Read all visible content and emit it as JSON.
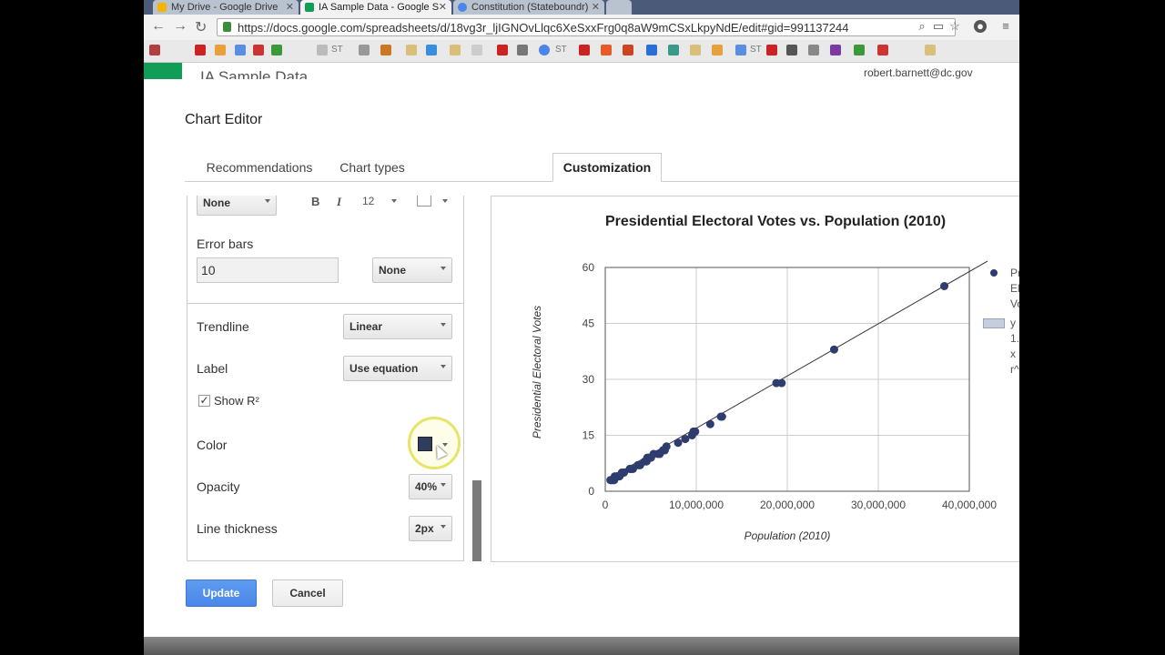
{
  "browser": {
    "tabs": [
      {
        "label": "My Drive - Google Drive"
      },
      {
        "label": "IA Sample Data - Google S"
      },
      {
        "label": "Constitution (Stateboundr)"
      }
    ],
    "url": "https://docs.google.com/spreadsheets/d/18vg3r_ljIGNOvLlqc6XeSxxFrg0q8aW9mCSxLkpyNdE/edit#gid=991137244",
    "bookmark_labels": [
      "ST",
      "ST",
      "ST"
    ]
  },
  "sheet": {
    "title": "IA Sample Data",
    "user_email": "robert.barnett@dc.gov"
  },
  "dialog": {
    "title": "Chart Editor",
    "tabs": [
      {
        "label": "Recommendations"
      },
      {
        "label": "Chart types"
      },
      {
        "label": "Customization"
      }
    ],
    "panel": {
      "point_shape_value": "None",
      "font_size": "12",
      "bold_label": "B",
      "italic_label": "I",
      "error_bars_label": "Error bars",
      "error_bars_value": "10",
      "error_bars_type": "None",
      "trendline_label": "Trendline",
      "trendline_value": "Linear",
      "label_label": "Label",
      "label_value": "Use equation",
      "show_r2_label": "Show R²",
      "show_r2_checked": "✓",
      "color_label": "Color",
      "color_value": "#2f3c5e",
      "opacity_label": "Opacity",
      "opacity_value": "40%",
      "thickness_label": "Line thickness",
      "thickness_value": "2px"
    },
    "update_label": "Update",
    "cancel_label": "Cancel"
  },
  "chart_data": {
    "type": "scatter",
    "title": "Presidential Electoral Votes vs. Population (2010)",
    "xlabel": "Population (2010)",
    "ylabel": "Presidential Electoral Votes",
    "xlim": [
      0,
      40000000
    ],
    "ylim": [
      0,
      60
    ],
    "x_ticks": [
      "0",
      "10,000,000",
      "20,000,000",
      "30,000,000",
      "40,000,000"
    ],
    "y_ticks": [
      "0",
      "15",
      "30",
      "45",
      "60"
    ],
    "grid": true,
    "legend_position": "right",
    "legend": [
      "Pr",
      "El",
      "Vo",
      "y",
      "1.",
      "x",
      "r^"
    ],
    "point_color": "#2f3c6e",
    "trendline": {
      "type": "linear",
      "slope": 1.4e-06,
      "intercept": 2.9,
      "color": "#333333"
    },
    "points": [
      [
        563626,
        3
      ],
      [
        625741,
        3
      ],
      [
        710231,
        3
      ],
      [
        814180,
        3
      ],
      [
        897934,
        3
      ],
      [
        989415,
        3
      ],
      [
        1052567,
        4
      ],
      [
        1316470,
        4
      ],
      [
        1328361,
        4
      ],
      [
        1360301,
        4
      ],
      [
        1567582,
        4
      ],
      [
        1826341,
        5
      ],
      [
        1852994,
        5
      ],
      [
        2059179,
        5
      ],
      [
        2700551,
        6
      ],
      [
        2763885,
        6
      ],
      [
        2853118,
        6
      ],
      [
        2967297,
        6
      ],
      [
        3046355,
        6
      ],
      [
        3574097,
        7
      ],
      [
        3751351,
        7
      ],
      [
        3831074,
        7
      ],
      [
        4339367,
        8
      ],
      [
        4533372,
        8
      ],
      [
        4625364,
        9
      ],
      [
        4779736,
        9
      ],
      [
        5029196,
        9
      ],
      [
        5303925,
        10
      ],
      [
        5773552,
        10
      ],
      [
        5988927,
        10
      ],
      [
        6346105,
        11
      ],
      [
        6392017,
        11
      ],
      [
        6483802,
        11
      ],
      [
        6547629,
        11
      ],
      [
        6724540,
        12
      ],
      [
        8001024,
        13
      ],
      [
        8791894,
        14
      ],
      [
        9535483,
        15
      ],
      [
        9687653,
        16
      ],
      [
        9883640,
        16
      ],
      [
        11536504,
        18
      ],
      [
        12702379,
        20
      ],
      [
        12830632,
        20
      ],
      [
        18801310,
        29
      ],
      [
        19378102,
        29
      ],
      [
        25145561,
        38
      ],
      [
        37253956,
        55
      ]
    ]
  }
}
